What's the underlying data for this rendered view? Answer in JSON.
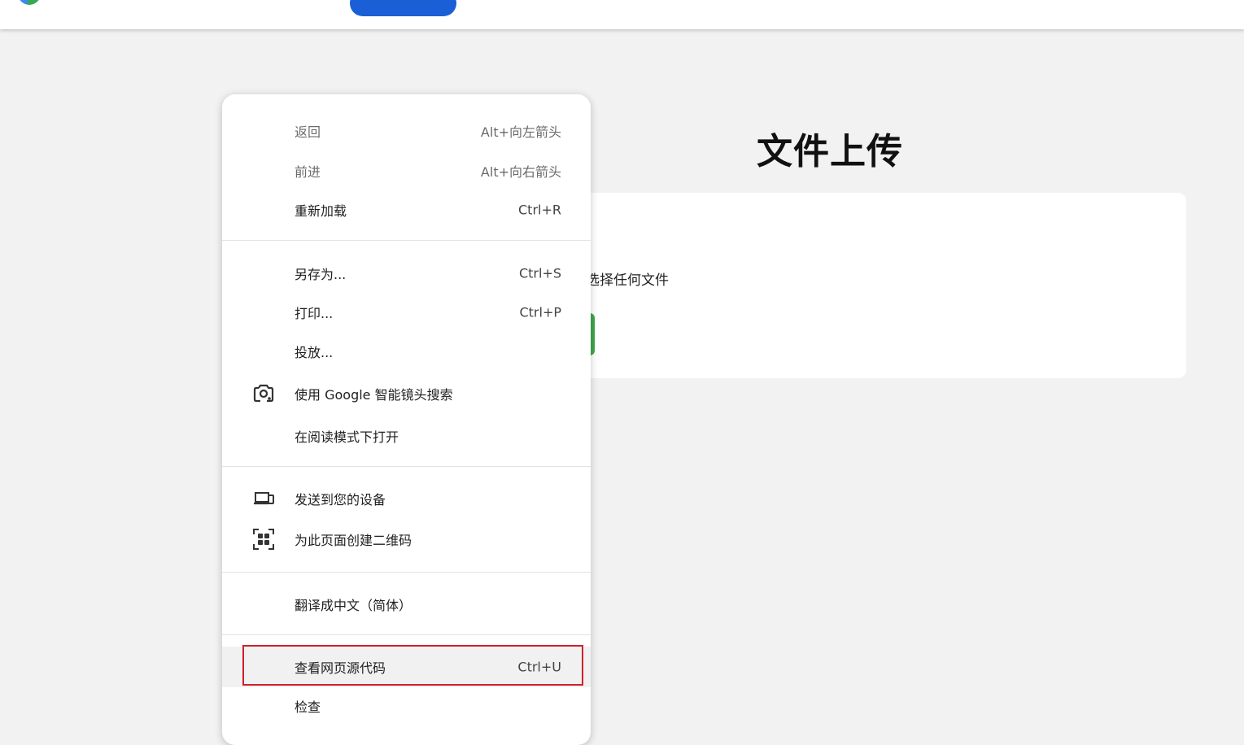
{
  "page": {
    "title": "文件上传",
    "card_hint": "选择任何文件"
  },
  "context_menu": {
    "items": [
      {
        "label": "返回",
        "shortcut": "Alt+向左箭头",
        "disabled": true
      },
      {
        "label": "前进",
        "shortcut": "Alt+向右箭头",
        "disabled": true
      },
      {
        "label": "重新加载",
        "shortcut": "Ctrl+R"
      },
      {
        "label": "另存为...",
        "shortcut": "Ctrl+S"
      },
      {
        "label": "打印...",
        "shortcut": "Ctrl+P"
      },
      {
        "label": "投放..."
      },
      {
        "label": "使用 Google 智能镜头搜索",
        "icon": "google-lens-icon"
      },
      {
        "label": "在阅读模式下打开"
      },
      {
        "label": "发送到您的设备",
        "icon": "devices-icon"
      },
      {
        "label": "为此页面创建二维码",
        "icon": "qr-code-icon"
      },
      {
        "label": "翻译成中文（简体）"
      },
      {
        "label": "查看网页源代码",
        "shortcut": "Ctrl+U",
        "highlighted": true
      },
      {
        "label": "检查"
      }
    ]
  },
  "colors": {
    "highlight_border": "#d0202a",
    "top_button": "#1a5fd6",
    "green_button": "#3fa84b"
  }
}
